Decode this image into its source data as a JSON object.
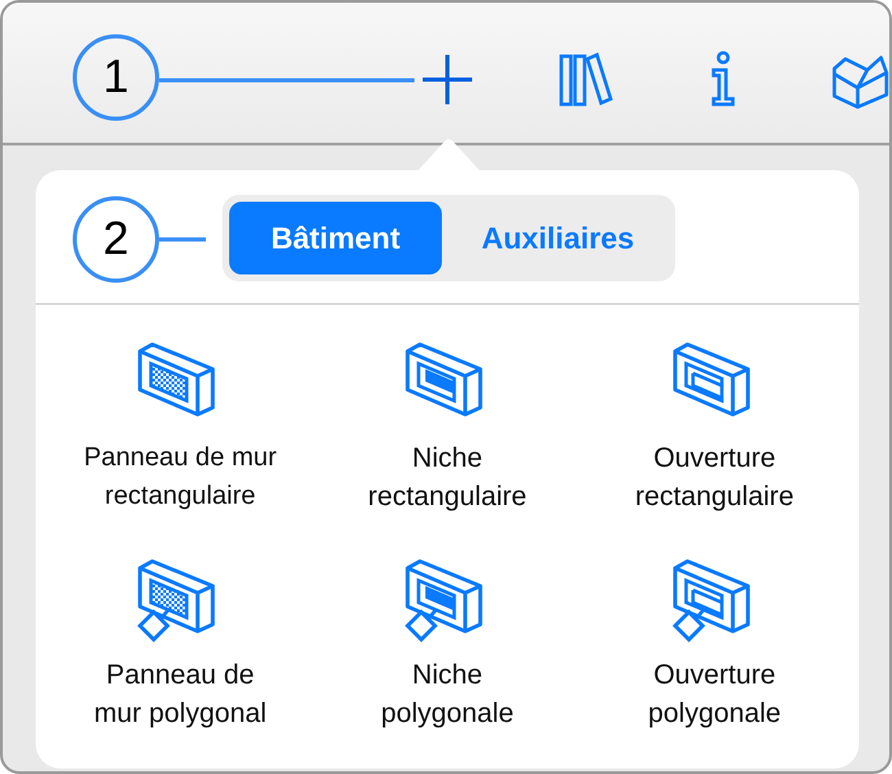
{
  "toolbar": {
    "callout": "1",
    "tools": [
      {
        "kind": "add",
        "selected": true
      },
      {
        "kind": "library"
      },
      {
        "kind": "info"
      },
      {
        "kind": "objects"
      }
    ]
  },
  "popover": {
    "callout": "2",
    "segments": [
      {
        "label": "Bâtiment",
        "selected": true
      },
      {
        "label": "Auxiliaires",
        "selected": false
      }
    ],
    "items": [
      {
        "label": "Panneau de mur\nrectangulaire",
        "kind": "panel",
        "polygonal": false
      },
      {
        "label": "Niche\nrectangulaire",
        "kind": "niche",
        "polygonal": false
      },
      {
        "label": "Ouverture\nrectangulaire",
        "kind": "opening",
        "polygonal": false
      },
      {
        "label": "Panneau de\nmur polygonal",
        "kind": "panel",
        "polygonal": true
      },
      {
        "label": "Niche\npolygonale",
        "kind": "niche",
        "polygonal": true
      },
      {
        "label": "Ouverture\npolygonale",
        "kind": "opening",
        "polygonal": true
      }
    ]
  }
}
